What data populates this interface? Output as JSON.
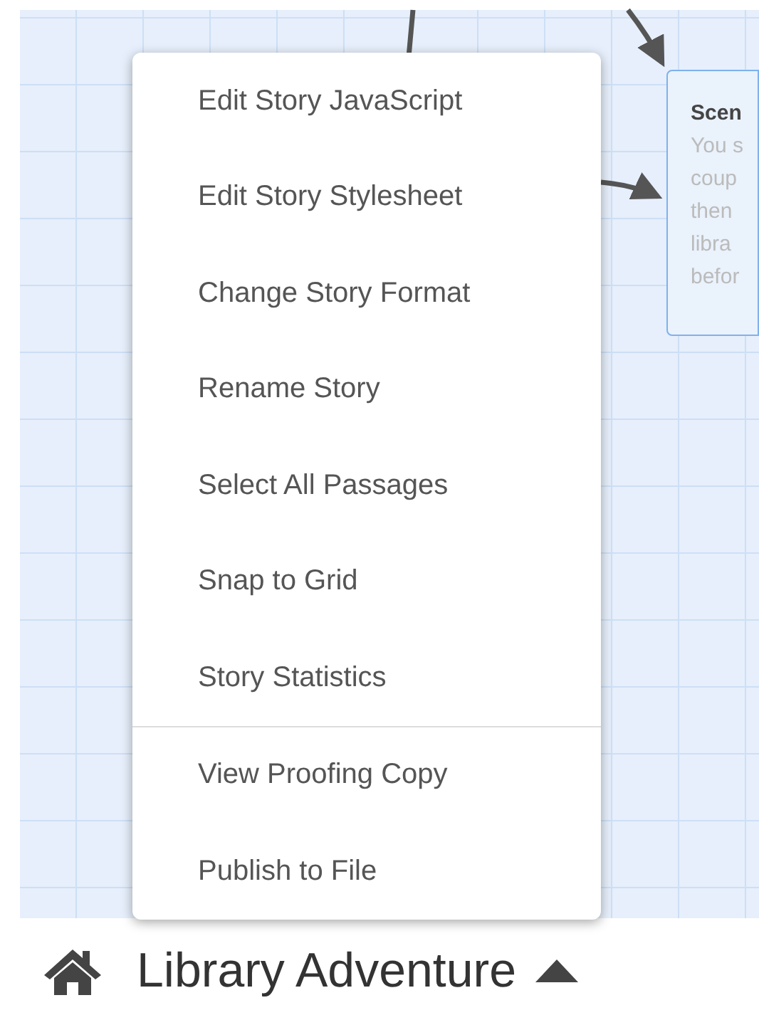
{
  "passage": {
    "title": "Scen",
    "excerpt_lines": [
      "You s",
      "coup",
      "then",
      "libra",
      "befor"
    ]
  },
  "menu": {
    "sections": [
      {
        "items": [
          "Edit Story JavaScript",
          "Edit Story Stylesheet",
          "Change Story Format",
          "Rename Story",
          "Select All Passages",
          "Snap to Grid",
          "Story Statistics"
        ]
      },
      {
        "items": [
          "View Proofing Copy",
          "Publish to File"
        ]
      }
    ]
  },
  "footer": {
    "story_title": "Library Adventure"
  }
}
